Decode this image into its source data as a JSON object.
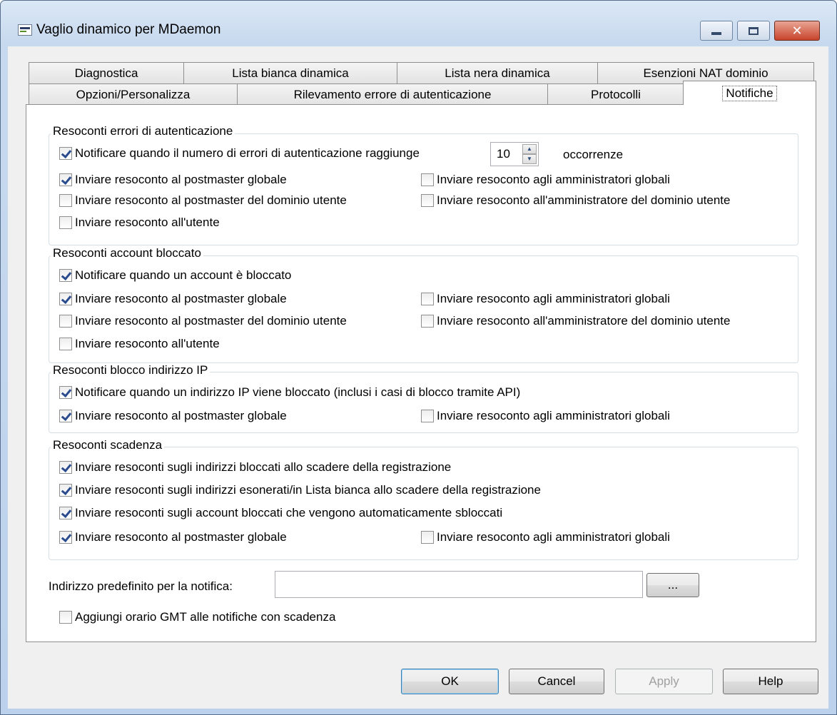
{
  "window": {
    "title": "Vaglio dinamico per MDaemon"
  },
  "tabs_row1": [
    "Diagnostica",
    "Lista bianca dinamica",
    "Lista nera dinamica",
    "Esenzioni NAT dominio"
  ],
  "tabs_row2": [
    "Opzioni/Personalizza",
    "Rilevamento errore di autenticazione",
    "Protocolli",
    "Notifiche"
  ],
  "active_tab": "Notifiche",
  "groups": {
    "auth_errors": {
      "title": "Resoconti errori di autenticazione",
      "notify_label": "Notificare quando il numero di errori di autenticazione raggiunge",
      "notify_checked": true,
      "threshold_value": "10",
      "occurrences_label": "occorrenze",
      "global_postmaster": {
        "label": "Inviare resoconto al postmaster globale",
        "checked": true
      },
      "global_admins": {
        "label": "Inviare resoconto agli amministratori globali",
        "checked": false
      },
      "domain_postmaster": {
        "label": "Inviare resoconto al postmaster del dominio utente",
        "checked": false
      },
      "domain_admin": {
        "label": "Inviare resoconto all'amministratore del dominio utente",
        "checked": false
      },
      "user": {
        "label": "Inviare resoconto all'utente",
        "checked": false
      }
    },
    "account_locked": {
      "title": "Resoconti account bloccato",
      "notify_label": "Notificare quando un account è bloccato",
      "notify_checked": true,
      "global_postmaster": {
        "label": "Inviare resoconto al postmaster globale",
        "checked": true
      },
      "global_admins": {
        "label": "Inviare resoconto agli amministratori globali",
        "checked": false
      },
      "domain_postmaster": {
        "label": "Inviare resoconto al postmaster del dominio utente",
        "checked": false
      },
      "domain_admin": {
        "label": "Inviare resoconto all'amministratore del dominio utente",
        "checked": false
      },
      "user": {
        "label": "Inviare resoconto all'utente",
        "checked": false
      }
    },
    "ip_block": {
      "title": "Resoconti blocco indirizzo IP",
      "notify_label": "Notificare quando un indirizzo IP viene bloccato (inclusi i casi di blocco tramite API)",
      "notify_checked": true,
      "global_postmaster": {
        "label": "Inviare resoconto al postmaster globale",
        "checked": true
      },
      "global_admins": {
        "label": "Inviare resoconto agli amministratori globali",
        "checked": false
      }
    },
    "expiry": {
      "title": "Resoconti scadenza",
      "blocked_addresses": {
        "label": "Inviare resoconti sugli indirizzi bloccati allo scadere della registrazione",
        "checked": true
      },
      "exempt_addresses": {
        "label": "Inviare resoconti sugli indirizzi esonerati/in Lista bianca allo scadere della registrazione",
        "checked": true
      },
      "unlocked_accounts": {
        "label": "Inviare resoconti sugli account bloccati che vengono automaticamente sbloccati",
        "checked": true
      },
      "global_postmaster": {
        "label": "Inviare resoconto al postmaster globale",
        "checked": true
      },
      "global_admins": {
        "label": "Inviare resoconto agli amministratori globali",
        "checked": false
      }
    }
  },
  "default_address": {
    "label": "Indirizzo predefinito per la notifica:",
    "value": "",
    "browse_label": "..."
  },
  "gmt_option": {
    "label": "Aggiungi orario GMT alle notifiche con scadenza",
    "checked": false
  },
  "buttons": {
    "ok": "OK",
    "cancel": "Cancel",
    "apply": "Apply",
    "help": "Help"
  }
}
